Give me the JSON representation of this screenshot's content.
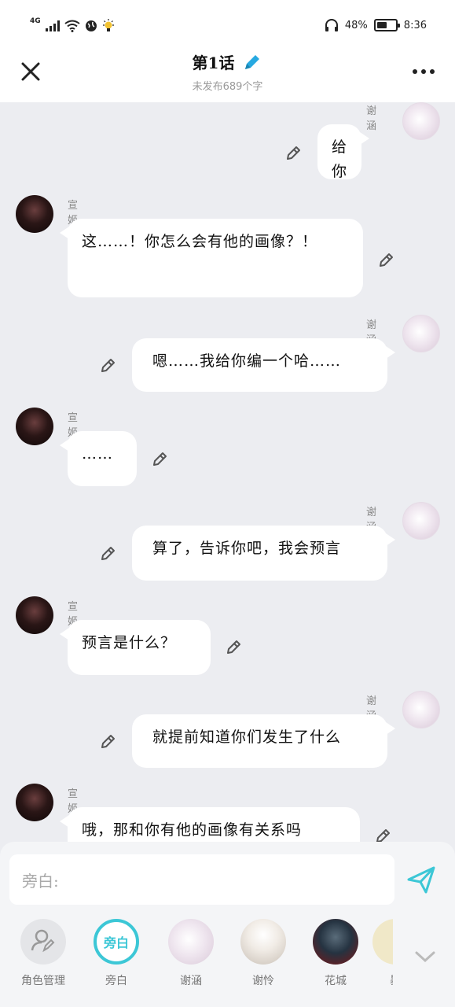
{
  "status_bar": {
    "network": "4G",
    "battery": "48%",
    "time": "8:36"
  },
  "header": {
    "title": "第1话",
    "subtitle": "未发布689个字"
  },
  "colors": {
    "accent": "#3cc7d6",
    "edit_blue": "#27a9e1",
    "bubble_bg": "#ffffff",
    "chat_bg": "#ecedf1"
  },
  "messages": [
    {
      "side": "right",
      "name": "谢涵",
      "text": "给你"
    },
    {
      "side": "left",
      "name": "宣姬",
      "text": "这……！你怎么会有他的画像？！"
    },
    {
      "side": "right",
      "name": "谢涵",
      "text": "嗯……我给你编一个哈……"
    },
    {
      "side": "left",
      "name": "宣姬",
      "text": "……"
    },
    {
      "side": "right",
      "name": "谢涵",
      "text": "算了，告诉你吧，我会预言"
    },
    {
      "side": "left",
      "name": "宣姬",
      "text": "预言是什么？"
    },
    {
      "side": "right",
      "name": "谢涵",
      "text": "就提前知道你们发生了什么"
    },
    {
      "side": "left",
      "name": "宣姬",
      "text": "哦，那和你有他的画像有关系吗"
    }
  ],
  "composer": {
    "placeholder": "旁白:"
  },
  "roles": [
    {
      "label": "角色管理",
      "icon": "user-edit-icon"
    },
    {
      "label": "旁白",
      "icon_text": "旁白"
    },
    {
      "label": "谢涵"
    },
    {
      "label": "谢怜"
    },
    {
      "label": "花城"
    },
    {
      "label": "暴"
    }
  ]
}
